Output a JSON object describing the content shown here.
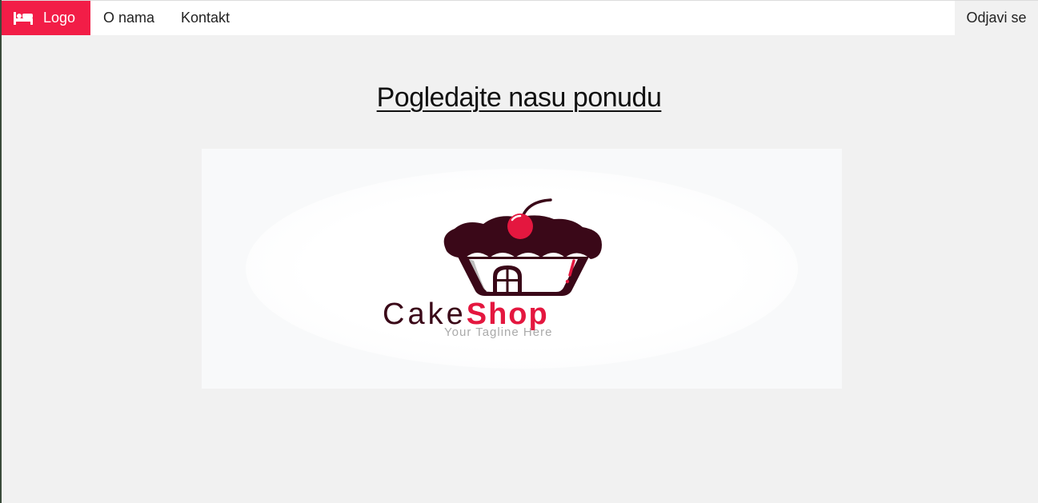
{
  "colors": {
    "accent": "#f21d47",
    "page_background": "#f1f1f1",
    "navbar_background": "#ffffff",
    "logo_dark": "#3a0818",
    "logo_red": "#e4173f"
  },
  "navbar": {
    "logo_icon": "bed-icon",
    "logo_label": "Logo",
    "links": [
      "O nama",
      "Kontakt"
    ],
    "logout_label": "Odjavi se"
  },
  "main": {
    "heading": "Pogledajte nasu ponudu",
    "promo": {
      "brand_part1": "Cake",
      "brand_part2": "Shop",
      "tagline": "Your Tagline Here"
    }
  }
}
